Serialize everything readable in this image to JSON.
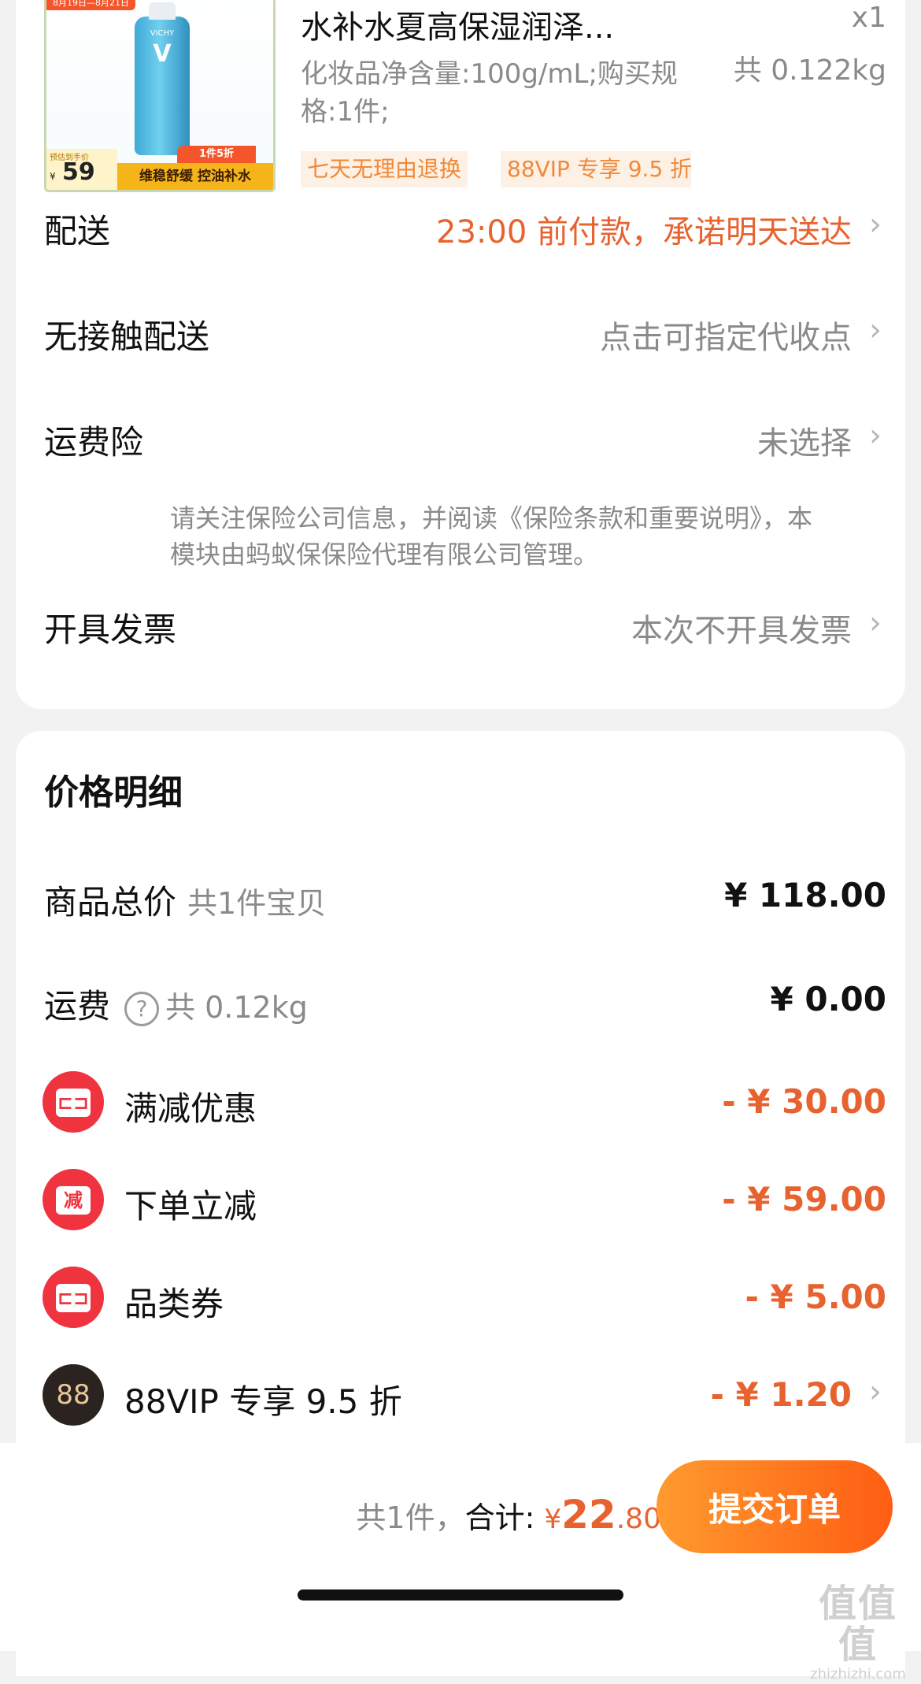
{
  "product": {
    "date_range": "8月19日—8月21日",
    "brand": "VICHY",
    "image_price_label": "预估到手价",
    "image_price_currency": "¥",
    "image_price": "59",
    "image_promo_top": "1件5折",
    "image_promo": "维稳舒缓 控油补水",
    "title": "水补水夏高保湿润泽...",
    "spec": "化妆品净含量:100g/mL;购买规格:1件;",
    "quantity": "x1",
    "weight": "共 0.122kg",
    "tags": [
      "七天无理由退换",
      "88VIP 专享 9.5 折"
    ]
  },
  "delivery": {
    "label": "配送",
    "value": "23:00 前付款，承诺明天送达"
  },
  "contactless": {
    "label": "无接触配送",
    "value": "点击可指定代收点"
  },
  "insurance": {
    "label": "运费险",
    "value": "未选择",
    "note": "请关注保险公司信息，并阅读《保险条款和重要说明》，本模块由蚂蚁保保险代理有限公司管理。"
  },
  "invoice": {
    "label": "开具发票",
    "value": "本次不开具发票"
  },
  "price_detail": {
    "title": "价格明细",
    "total": {
      "label": "商品总价",
      "sub": "共1件宝贝",
      "value": "¥ 118.00"
    },
    "shipping": {
      "label": "运费",
      "help_icon": "?",
      "sub": "共 0.12kg",
      "value": "¥ 0.00"
    },
    "discounts": [
      {
        "label": "满减优惠",
        "value": "- ¥ 30.00",
        "icon": "ticket-icon"
      },
      {
        "label": "下单立减",
        "value": "- ¥ 59.00",
        "icon": "reduce-icon",
        "icon_text": "减"
      },
      {
        "label": "品类券",
        "value": "- ¥ 5.00",
        "icon": "ticket-icon"
      },
      {
        "label": "88VIP 专享 9.5 折",
        "value": "- ¥ 1.20",
        "icon": "vip-icon",
        "icon_text": "88"
      }
    ]
  },
  "footer": {
    "count": "共1件，",
    "total_label": "合计:",
    "currency": "¥",
    "total_int": "22",
    "total_dec": ".80",
    "submit": "提交订单"
  },
  "watermark": {
    "top": "值值值",
    "bottom": "zhizhizhi.com"
  },
  "colors": {
    "accent": "#e8622f",
    "button_start": "#ff9a2e",
    "button_end": "#ff5d13",
    "coupon_red": "#f0343f"
  }
}
